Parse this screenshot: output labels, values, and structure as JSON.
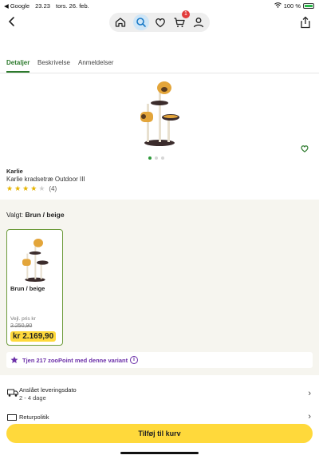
{
  "status_bar": {
    "carrier": "◀ Google",
    "time": "23.23",
    "date": "tors. 26. feb.",
    "battery": "100 %"
  },
  "nav": {
    "cart_badge": "1"
  },
  "tabs": [
    {
      "label": "Detaljer",
      "active": true
    },
    {
      "label": "Beskrivelse",
      "active": false
    },
    {
      "label": "Anmeldelser",
      "active": false
    }
  ],
  "product": {
    "brand": "Karlie",
    "title": "Karlie kradsetræ Outdoor III",
    "rating_stars": 4,
    "rating_count": "(4)"
  },
  "variant": {
    "label_prefix": "Valgt: ",
    "label_value": "Brun / beige",
    "card": {
      "name": "Brun / beige",
      "ref_price_label": "Vejl. pris kr",
      "ref_price": "2.250,90",
      "price": "kr 2.169,90"
    }
  },
  "zoopoint": {
    "text": "Tjen 217 zooPoint med denne variant"
  },
  "delivery": {
    "title": "Anslået leveringsdato",
    "subtitle": "2 - 4 dage"
  },
  "returns": {
    "title": "Returpolitik"
  },
  "cta": {
    "label": "Tilføj til kurv"
  },
  "colors": {
    "accent_green": "#2d7a2d",
    "price_yellow": "#ffd93b",
    "zoopoint_purple": "#6b2fa8"
  }
}
